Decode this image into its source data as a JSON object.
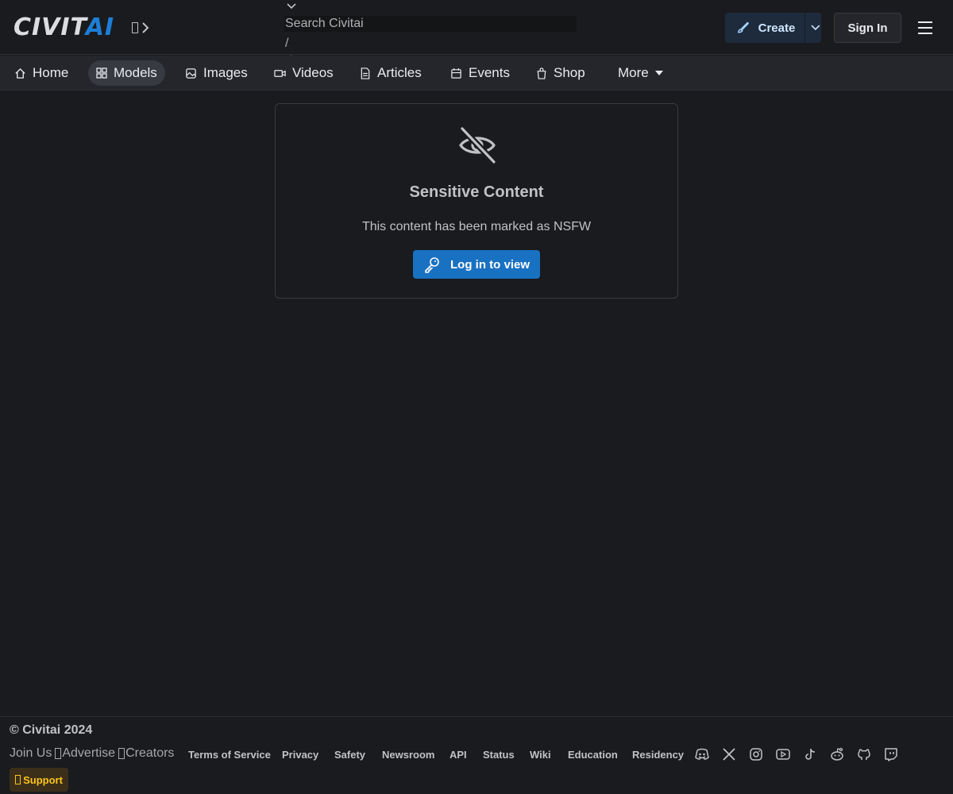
{
  "header": {
    "logo": {
      "part1": "CIVIT",
      "part2": "AI"
    },
    "search": {
      "placeholder": "Search Civitai",
      "shortcut": "/"
    },
    "create_label": "Create",
    "signin_label": "Sign In"
  },
  "nav": {
    "items": [
      {
        "label": "Home",
        "icon": "home-icon"
      },
      {
        "label": "Models",
        "icon": "grid-icon",
        "active": true
      },
      {
        "label": "Images",
        "icon": "photo-icon"
      },
      {
        "label": "Videos",
        "icon": "video-icon"
      },
      {
        "label": "Articles",
        "icon": "file-text-icon"
      },
      {
        "label": "Events",
        "icon": "calendar-icon"
      },
      {
        "label": "Shop",
        "icon": "shopping-bag-icon"
      },
      {
        "label": "More",
        "icon": "caret-down-icon"
      }
    ]
  },
  "content": {
    "title": "Sensitive Content",
    "description": "This content has been marked as NSFW",
    "login_label": "Log in to view"
  },
  "footer": {
    "copyright": "© Civitai 2024",
    "join_us": "Join Us",
    "advertise": "Advertise",
    "creators": "Creators",
    "links": [
      "Terms of Service",
      "Privacy",
      "Safety",
      "Newsroom",
      "API",
      "Status",
      "Wiki",
      "Education",
      "Residency"
    ],
    "socials": [
      "discord-icon",
      "x-icon",
      "instagram-icon",
      "youtube-icon",
      "tiktok-icon",
      "reddit-icon",
      "github-icon",
      "twitch-icon"
    ],
    "support_label": "Support"
  },
  "colors": {
    "accent": "#1971c2",
    "background": "#1a1b1e",
    "support": "#fcc419"
  }
}
